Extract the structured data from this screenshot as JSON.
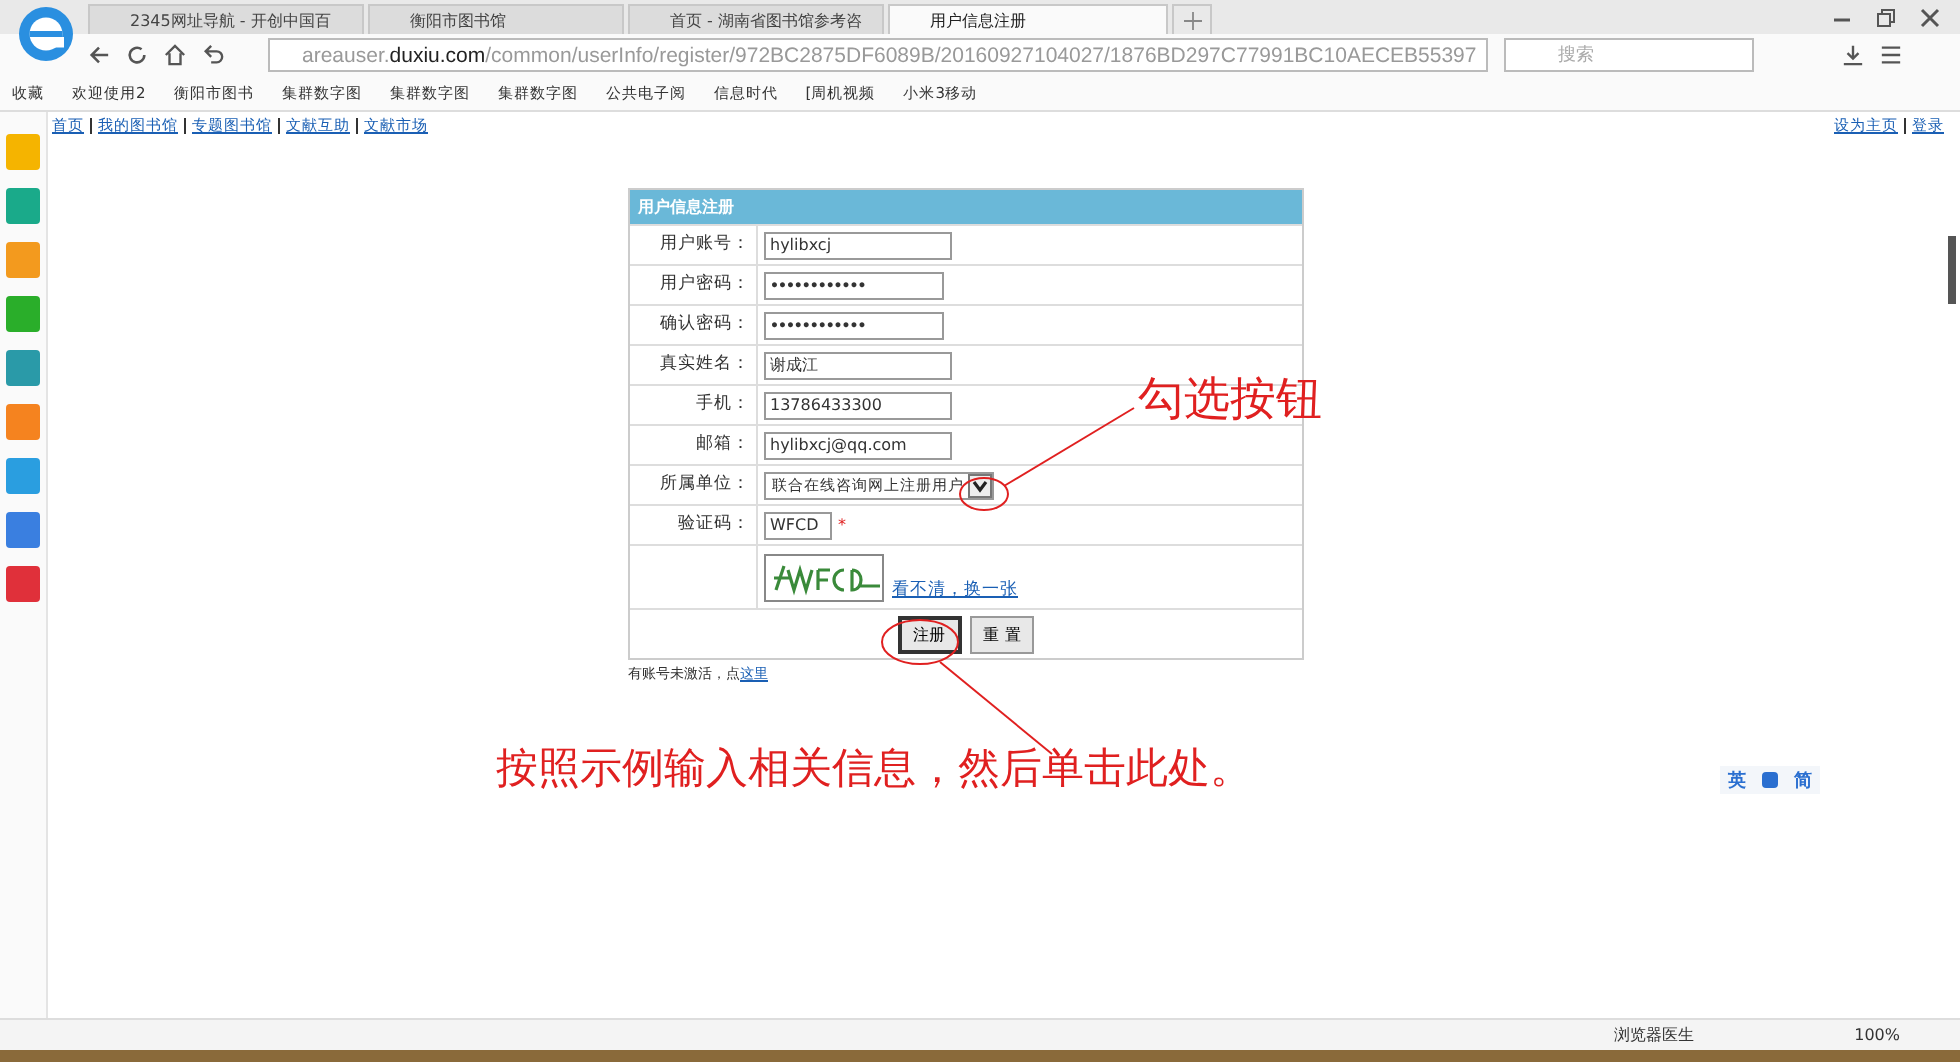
{
  "tabs": [
    {
      "title": "2345网址导航 - 开创中国百",
      "selected": false
    },
    {
      "title": "衡阳市图书馆",
      "selected": false
    },
    {
      "title": "首页 - 湖南省图书馆参考咨",
      "selected": false
    },
    {
      "title": "用户信息注册",
      "selected": true
    }
  ],
  "address": {
    "url": "areauser.**duxiu.com**/common/userInfo/register/972BC2875DF6089B/20160927104027/1876BD297C77991BC10AECEB55397"
  },
  "search": {
    "placeholder": "搜索"
  },
  "bookmarks": [
    "收藏",
    "欢迎使用2",
    "衡阳市图书",
    "集群数字图",
    "集群数字图",
    "集群数字图",
    "公共电子阅",
    "信息时代",
    "[周机视频",
    "小米3移动"
  ],
  "top_links": [
    "首页",
    "我的图书馆",
    "专题图书馆",
    "文献互助",
    "文献市场"
  ],
  "right_links": [
    "设为主页",
    "登录"
  ],
  "form": {
    "title": "用户信息注册",
    "rows": [
      {
        "label": "用户账号：",
        "kind": "text",
        "value": "hylibxcj"
      },
      {
        "label": "用户密码：",
        "kind": "password",
        "value": "••••••••••••"
      },
      {
        "label": "确认密码：",
        "kind": "password",
        "value": "••••••••••••"
      },
      {
        "label": "真实姓名：",
        "kind": "text",
        "value": "谢成江"
      },
      {
        "label": "手机：",
        "kind": "text",
        "value": "13786433300"
      },
      {
        "label": "邮箱：",
        "kind": "text",
        "value": "hylibxcj@qq.com"
      },
      {
        "label": "所属单位：",
        "kind": "select",
        "value": "联合在线咨询网上注册用户"
      },
      {
        "label": "验证码：",
        "kind": "captcha",
        "value": "WFCD",
        "required_mark": "*"
      }
    ],
    "refresh_link": "看不清，换一张",
    "buttons": [
      "注册",
      "重 置"
    ]
  },
  "note": {
    "text": "有账号未激活，点",
    "link": "这里"
  },
  "annotations": [
    "勾选按钮",
    "按照示例输入相关信息，然后单击此处。"
  ],
  "ime": [
    "英",
    "简"
  ],
  "status": {
    "doctor": "浏览器医生",
    "zoom": "100%"
  }
}
